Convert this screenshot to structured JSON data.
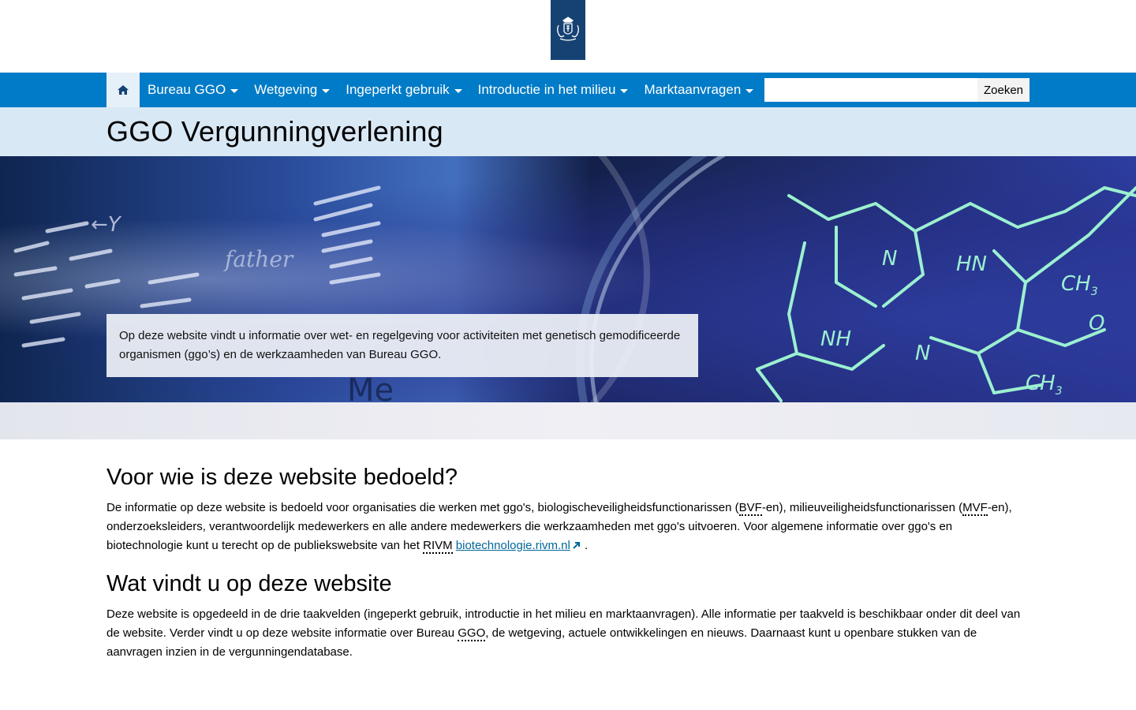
{
  "header": {
    "logo_alt": "Rijksoverheid"
  },
  "nav": {
    "home_icon": "home-icon",
    "items": [
      {
        "label": "Bureau GGO"
      },
      {
        "label": "Wetgeving"
      },
      {
        "label": "Ingeperkt gebruik"
      },
      {
        "label": "Introductie in het milieu"
      },
      {
        "label": "Marktaanvragen"
      }
    ],
    "search_value": "",
    "search_button": "Zoeken"
  },
  "page": {
    "title": "GGO Vergunningverlening"
  },
  "hero": {
    "text": "Op deze website vindt u informatie over wet- en regelgeving voor activiteiten met genetisch gemodificeerde organismen (ggo’s) en de werkzaamheden van Bureau GGO."
  },
  "section1": {
    "heading": "Voor wie is deze website bedoeld?",
    "p_a": "De informatie op deze website is bedoeld voor organisaties die werken met ggo's, biologischeveiligheidsfunctionarissen (",
    "abbr_bvf": "BVF",
    "p_b": "-en), milieuveiligheidsfunctionarissen (",
    "abbr_mvf": "MVF",
    "p_c": "-en), onderzoeksleiders, verantwoordelijk medewerkers en alle andere medewerkers die werkzaamheden met ggo's uitvoeren.  Voor algemene informatie over ggo's en biotechnologie kunt u terecht op de publiekswebsite van het ",
    "abbr_rivm": "RIVM",
    "link": "biotechnologie.rivm.nl",
    "p_d": " ."
  },
  "section2": {
    "heading": "Wat vindt u op deze website",
    "p_a": "Deze website is opgedeeld in de drie taakvelden (ingeperkt gebruik, introductie in het milieu en marktaanvragen). Alle informatie per taakveld is beschikbaar onder dit deel van de website. Verder vindt u op deze website informatie over Bureau ",
    "abbr_ggo": "GGO",
    "p_b": ", de wetgeving, actuele ontwikkelingen en nieuws. Daarnaast kunt u openbare stukken van de aanvragen inzien in de vergunningendatabase."
  },
  "colors": {
    "nav_bg": "#007bc7",
    "logo_bg": "#154273",
    "title_bg": "#d9e8f5",
    "link": "#01689b"
  }
}
